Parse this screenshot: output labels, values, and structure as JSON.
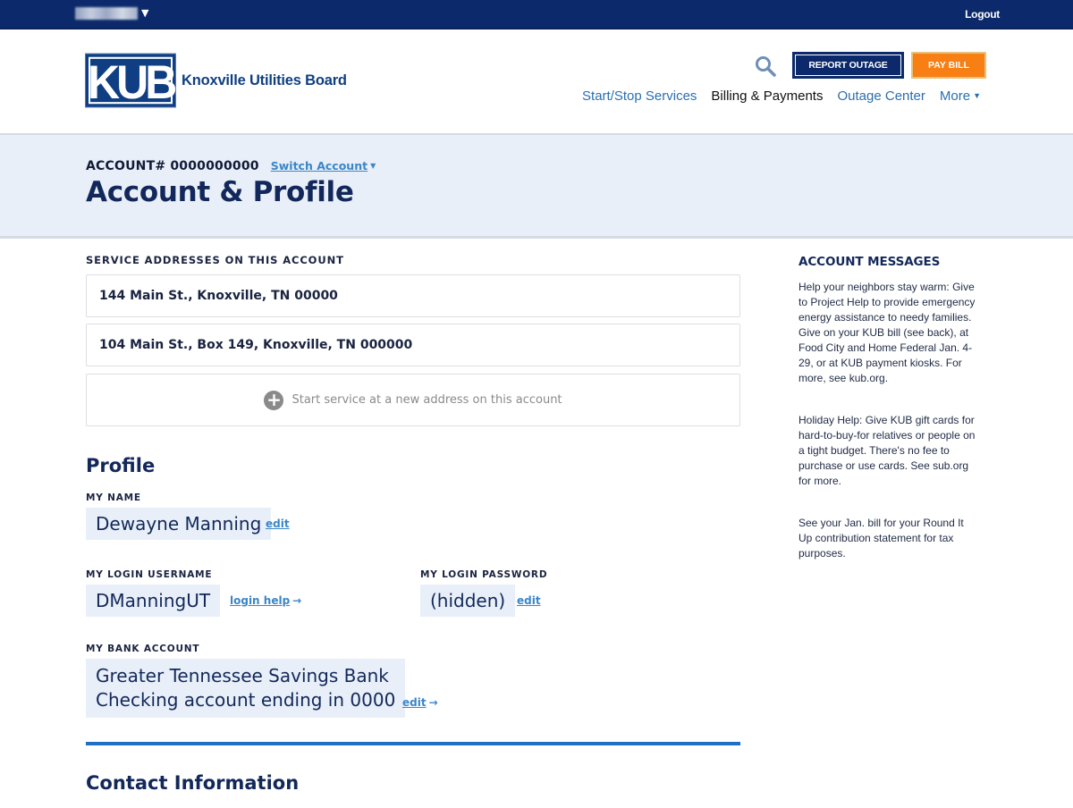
{
  "topbar": {
    "user_caret": "▼",
    "logout_label": "Logout"
  },
  "header": {
    "logo_mark": "KUB",
    "logo_text": "Knoxville Utilities Board",
    "report_outage_label": "REPORT OUTAGE",
    "pay_bill_label": "PAY BILL",
    "nav": [
      {
        "label": "Start/Stop Services"
      },
      {
        "label": "Billing & Payments"
      },
      {
        "label": "Outage Center"
      },
      {
        "label": "More"
      }
    ]
  },
  "banner": {
    "account_label": "ACCOUNT# 0000000000",
    "switch_account_label": "Switch Account",
    "title": "Account & Profile"
  },
  "service_addresses": {
    "label": "SERVICE ADDRESSES ON THIS ACCOUNT",
    "items": [
      "144 Main St., Knoxville, TN 00000",
      "104 Main St., Box 149, Knoxville, TN 000000"
    ],
    "new_address_label": "Start service at a new address on this account"
  },
  "profile": {
    "title": "Profile",
    "name_label": "MY NAME",
    "name_value": "Dewayne Manning",
    "name_edit": "edit",
    "username_label": "MY LOGIN USERNAME",
    "username_value": "DManningUT",
    "login_help": "login help",
    "password_label": "MY LOGIN PASSWORD",
    "password_value": "(hidden)",
    "password_edit": "edit",
    "bank_label": "MY BANK ACCOUNT",
    "bank_line1": "Greater Tennessee Savings Bank",
    "bank_line2": "Checking account ending in 0000",
    "bank_edit": "edit",
    "arrow": "→"
  },
  "contact": {
    "title": "Contact Information"
  },
  "account_messages": {
    "title": "ACCOUNT MESSAGES",
    "messages": [
      "Help your neighbors stay warm: Give to Project Help to provide emergency energy assistance to needy families. Give on your KUB bill (see back), at Food City and Home Federal Jan. 4-29, or at KUB payment kiosks. For more, see kub.org.",
      "Holiday Help: Give KUB gift cards for hard-to-buy-for relatives or people on a tight budget. There's no fee to purchase or use cards. See sub.org for more.",
      "See your Jan. bill for your Round It Up contribution statement for tax purposes."
    ]
  },
  "colors": {
    "navy": "#0c2a6b",
    "orange": "#f77f13",
    "link_blue": "#3b86c8",
    "banner_bg": "#e8eff8",
    "divider_blue": "#1f6fc5"
  }
}
